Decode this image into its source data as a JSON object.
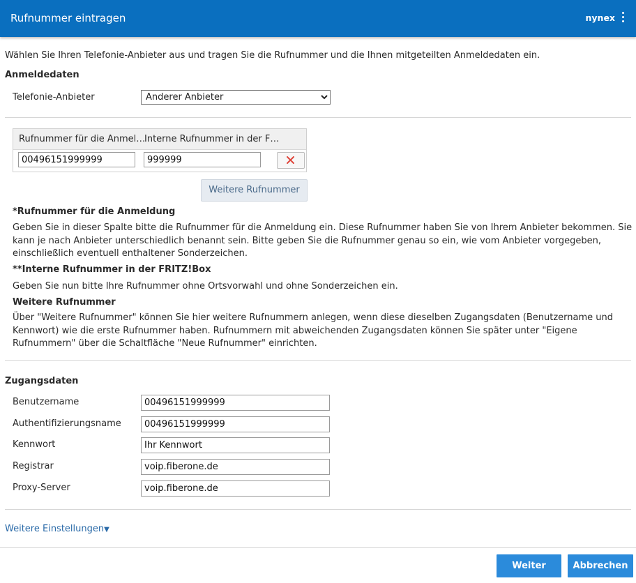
{
  "header": {
    "title": "Rufnummer eintragen",
    "brand": "nynex"
  },
  "intro": "Wählen Sie Ihren Telefonie-Anbieter aus und tragen Sie die Rufnummer und die Ihnen mitgeteilten Anmeldedaten ein.",
  "anmeldedaten": {
    "title": "Anmeldedaten",
    "provider_label": "Telefonie-Anbieter",
    "provider_value": "Anderer Anbieter"
  },
  "numbers_table": {
    "col1": "Rufnummer für die Anmel…",
    "col2": "Interne Rufnummer in der F…",
    "rows": [
      {
        "login_number": "00496151999999",
        "internal_number": "999999"
      }
    ],
    "more_button": "Weitere Rufnummer"
  },
  "help": {
    "h1": "*Rufnummer für die Anmeldung",
    "p1": "Geben Sie in dieser Spalte bitte die Rufnummer für die Anmeldung ein. Diese Rufnummer haben Sie von Ihrem Anbieter bekommen. Sie kann je nach Anbieter unterschiedlich benannt sein. Bitte geben Sie die Rufnummer genau so ein, wie vom Anbieter vorgegeben, einschließlich eventuell enthaltener Sonderzeichen.",
    "h2": "**Interne Rufnummer in der FRITZ!Box",
    "p2": "Geben Sie nun bitte Ihre Rufnummer ohne Ortsvorwahl und ohne Sonderzeichen ein.",
    "h3": "Weitere Rufnummer",
    "p3": "Über \"Weitere Rufnummer\" können Sie hier weitere Rufnummern anlegen, wenn diese dieselben Zugangsdaten (Benutzername und Kennwort) wie die erste Rufnummer haben. Rufnummern mit abweichenden Zugangsdaten können Sie später unter \"Eigene Rufnummern\" über die Schaltfläche \"Neue Rufnummer\" einrichten."
  },
  "zugangsdaten": {
    "title": "Zugangsdaten",
    "fields": [
      {
        "label": "Benutzername",
        "value": "00496151999999"
      },
      {
        "label": "Authentifizierungsname",
        "value": "00496151999999"
      },
      {
        "label": "Kennwort",
        "value": "Ihr Kennwort"
      },
      {
        "label": "Registrar",
        "value": "voip.fiberone.de"
      },
      {
        "label": "Proxy-Server",
        "value": "voip.fiberone.de"
      }
    ]
  },
  "more_settings": "Weitere Einstellungen",
  "footer": {
    "next": "Weiter",
    "cancel": "Abbrechen"
  },
  "colors": {
    "header_bg": "#0a6fbf",
    "primary_button": "#2b8bdb",
    "delete_icon": "#e0483e"
  }
}
